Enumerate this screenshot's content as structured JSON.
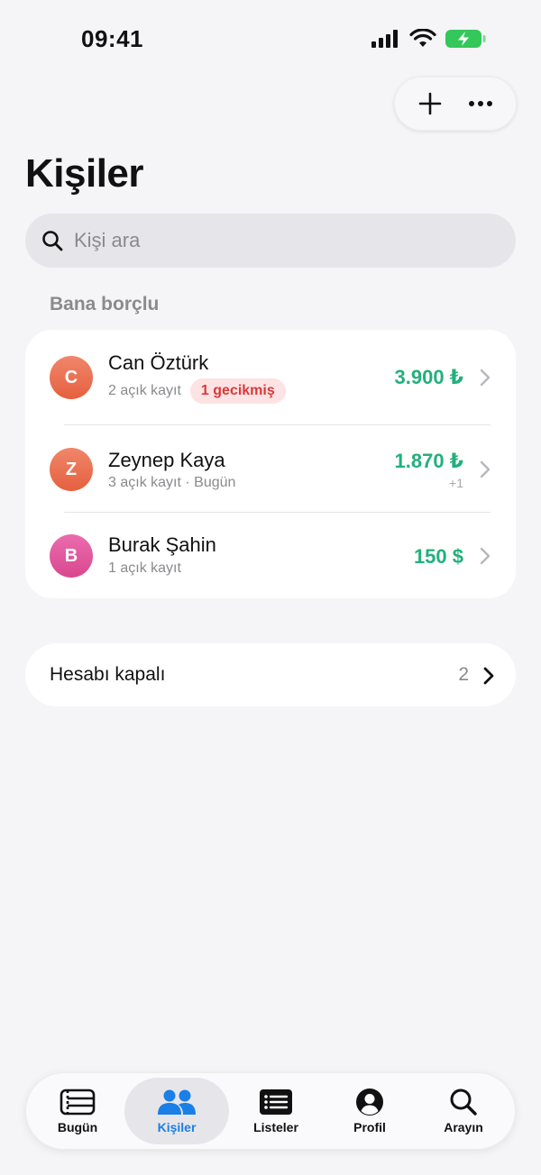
{
  "status_bar": {
    "time": "09:41"
  },
  "header": {
    "title": "Kişiler"
  },
  "search": {
    "placeholder": "Kişi ara"
  },
  "section": {
    "label": "Bana borçlu"
  },
  "contacts": [
    {
      "initial": "C",
      "name": "Can Öztürk",
      "subtitle": "2 açık kayıt",
      "badge": "1 gecikmiş",
      "amount": "3.900 ₺",
      "extra": "",
      "avatar_color": "#ec6f55"
    },
    {
      "initial": "Z",
      "name": "Zeynep Kaya",
      "subtitle": "3 açık kayıt · Bugün",
      "badge": "",
      "amount": "1.870 ₺",
      "extra": "+1",
      "avatar_color": "#ec6f55"
    },
    {
      "initial": "B",
      "name": "Burak Şahin",
      "subtitle": "1 açık kayıt",
      "badge": "",
      "amount": "150 $",
      "extra": "",
      "avatar_color": "#e0559c"
    }
  ],
  "closed_accounts": {
    "label": "Hesabı kapalı",
    "count": "2"
  },
  "tabs": [
    {
      "label": "Bugün",
      "icon": "today-icon",
      "active": false
    },
    {
      "label": "Kişiler",
      "icon": "people-icon",
      "active": true
    },
    {
      "label": "Listeler",
      "icon": "list-icon",
      "active": false
    },
    {
      "label": "Profil",
      "icon": "profile-icon",
      "active": false
    },
    {
      "label": "Arayın",
      "icon": "search-icon",
      "active": false
    }
  ],
  "colors": {
    "accent": "#1a7fe6",
    "positive": "#22b07d",
    "overdue": "#d9393b",
    "background": "#f5f5f8"
  }
}
